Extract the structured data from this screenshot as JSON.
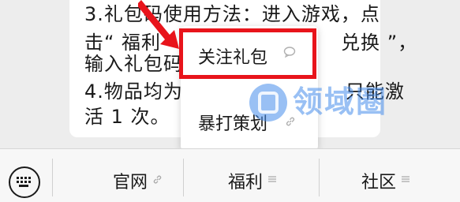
{
  "message": {
    "line1": "3.礼包码使用方法：进入游戏，点",
    "line2": "击“ 福利",
    "line2b": "兑换 ”，",
    "line3": "输入礼包码",
    "line4": "4.物品均为",
    "line4b": "只能激",
    "line5": "活 1 次。"
  },
  "popup_menu": {
    "items": [
      {
        "label": "关注礼包",
        "icon": "chat-bubble-icon"
      },
      {
        "label": "暴打策划",
        "icon": "link-icon"
      }
    ]
  },
  "watermark": {
    "text": "领域圈"
  },
  "bottom_menu": {
    "items": [
      {
        "label": "官网",
        "icon": "link-icon"
      },
      {
        "label": "福利",
        "icon": "menu-lines-icon"
      },
      {
        "label": "社区",
        "icon": "menu-lines-icon"
      }
    ]
  },
  "colors": {
    "highlight": "#e8141b",
    "background": "#ededed",
    "watermark": "#468ceb"
  }
}
